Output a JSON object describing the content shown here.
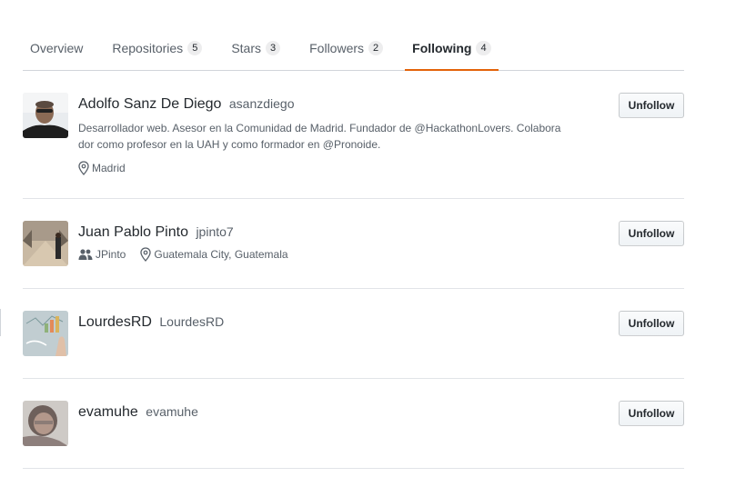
{
  "tabs": [
    {
      "label": "Overview",
      "count": ""
    },
    {
      "label": "Repositories",
      "count": "5"
    },
    {
      "label": "Stars",
      "count": "3"
    },
    {
      "label": "Followers",
      "count": "2"
    },
    {
      "label": "Following",
      "count": "4",
      "selected": true
    }
  ],
  "accent_color": "#e36209",
  "users": [
    {
      "full_name": "Adolfo Sanz De Diego",
      "login": "asanzdiego",
      "bio_line1": "Desarrollador web. Asesor en la Comunidad de Madrid. Fundador de @HackathonLovers. Colabora",
      "bio_line2": "dor como profesor en la UAH y como formador en @Pronoide.",
      "location": "Madrid",
      "location_icon": "location-pin-icon",
      "button_label": "Unfollow"
    },
    {
      "full_name": "Juan Pablo Pinto",
      "login": "jpinto7",
      "company": "JPinto",
      "company_icon": "people-icon",
      "location": "Guatemala City, Guatemala",
      "location_icon": "location-pin-icon",
      "button_label": "Unfollow"
    },
    {
      "full_name": "LourdesRD",
      "login": "LourdesRD",
      "button_label": "Unfollow"
    },
    {
      "full_name": "evamuhe",
      "login": "evamuhe",
      "button_label": "Unfollow"
    }
  ]
}
